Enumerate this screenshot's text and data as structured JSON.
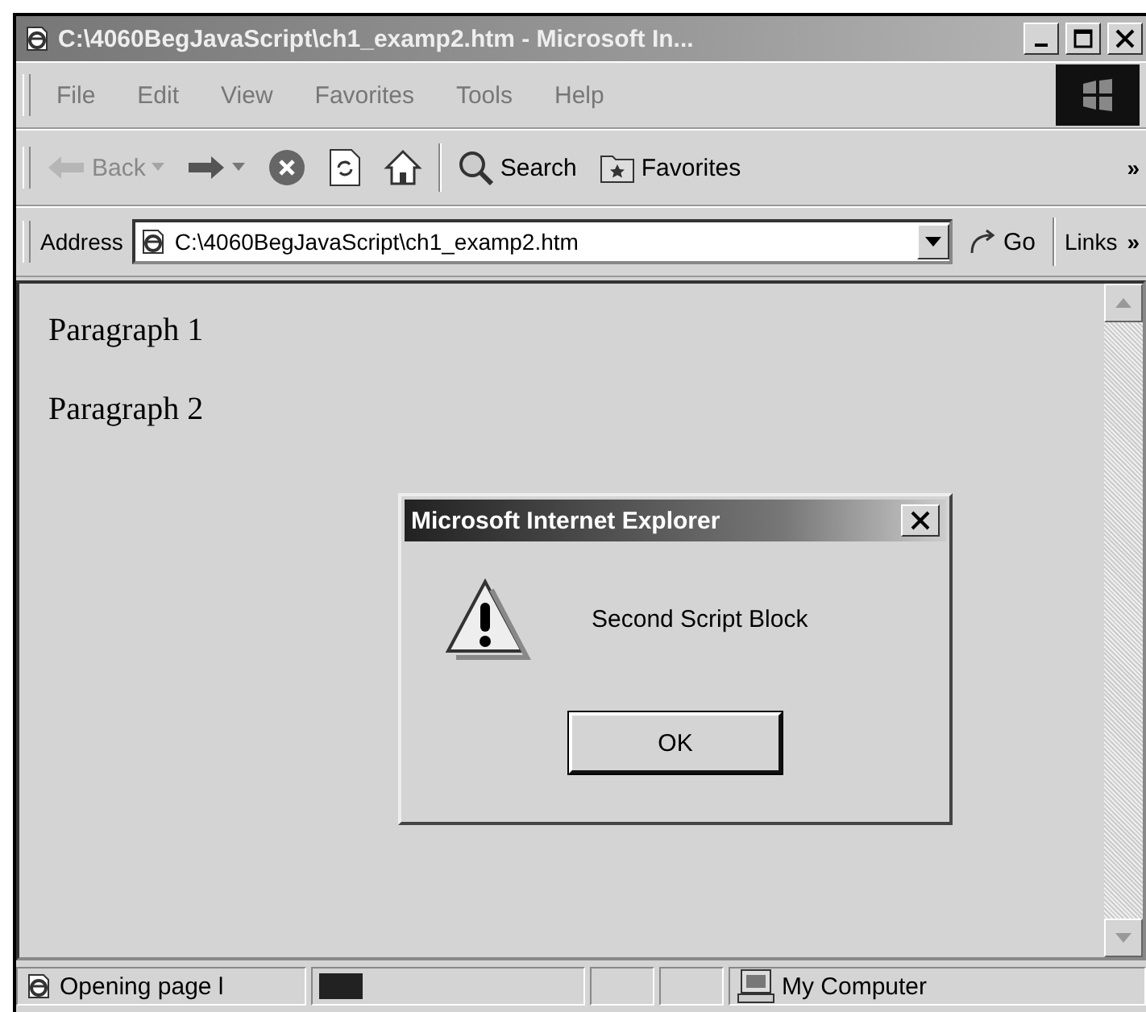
{
  "window": {
    "title": "C:\\4060BegJavaScript\\ch1_examp2.htm - Microsoft In..."
  },
  "menu": [
    "File",
    "Edit",
    "View",
    "Favorites",
    "Tools",
    "Help"
  ],
  "toolbar": [
    {
      "kind": "back",
      "label": "Back",
      "disabled": true
    },
    {
      "kind": "forward",
      "disabled": false
    },
    {
      "kind": "stop",
      "disabled": false
    },
    {
      "kind": "refresh",
      "disabled": false
    },
    {
      "kind": "home",
      "disabled": false
    },
    {
      "kind": "search",
      "label": "Search",
      "disabled": false
    },
    {
      "kind": "favorites",
      "label": "Favorites",
      "disabled": false
    }
  ],
  "toolbar_more": "»",
  "address": {
    "label": "Address",
    "value": "C:\\4060BegJavaScript\\ch1_examp2.htm",
    "go": "Go",
    "links": "Links",
    "links_more": "»"
  },
  "content": {
    "paragraphs": [
      "Paragraph 1",
      "Paragraph 2"
    ]
  },
  "dialog": {
    "title": "Microsoft Internet Explorer",
    "message": "Second Script Block",
    "button": "OK"
  },
  "status_bar": {
    "text": "Opening page l",
    "progress": {
      "level": 0.17
    },
    "zone": "My Computer"
  }
}
